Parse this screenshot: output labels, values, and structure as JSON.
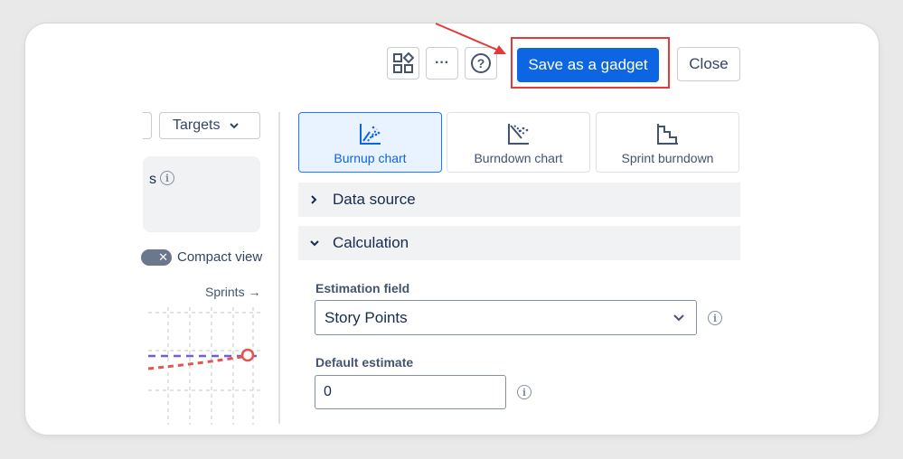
{
  "toolbar": {
    "save_label": "Save as a gadget",
    "close_label": "Close",
    "more_label": "···",
    "help_label": "?",
    "icons": [
      "grid-shapes-icon",
      "more-icon",
      "help-icon"
    ]
  },
  "left_pane": {
    "targets_label": "Targets",
    "panel_text": "s",
    "compact_view_label": "Compact view",
    "sprints_link": "Sprints →"
  },
  "chart_types": [
    {
      "label": "Burnup chart",
      "icon": "burnup-chart-icon",
      "selected": true
    },
    {
      "label": "Burndown chart",
      "icon": "burndown-chart-icon",
      "selected": false
    },
    {
      "label": "Sprint burndown",
      "icon": "sprint-burndown-icon",
      "selected": false
    }
  ],
  "sections": {
    "data_source": "Data source",
    "calculation": "Calculation"
  },
  "estimation_field": {
    "label": "Estimation field",
    "value": "Story Points"
  },
  "default_estimate": {
    "label": "Default estimate",
    "value": "0"
  },
  "colors": {
    "primary": "#0c66e4",
    "highlight": "#e23b3b",
    "selected_tile_bg": "#e9f2ff"
  }
}
